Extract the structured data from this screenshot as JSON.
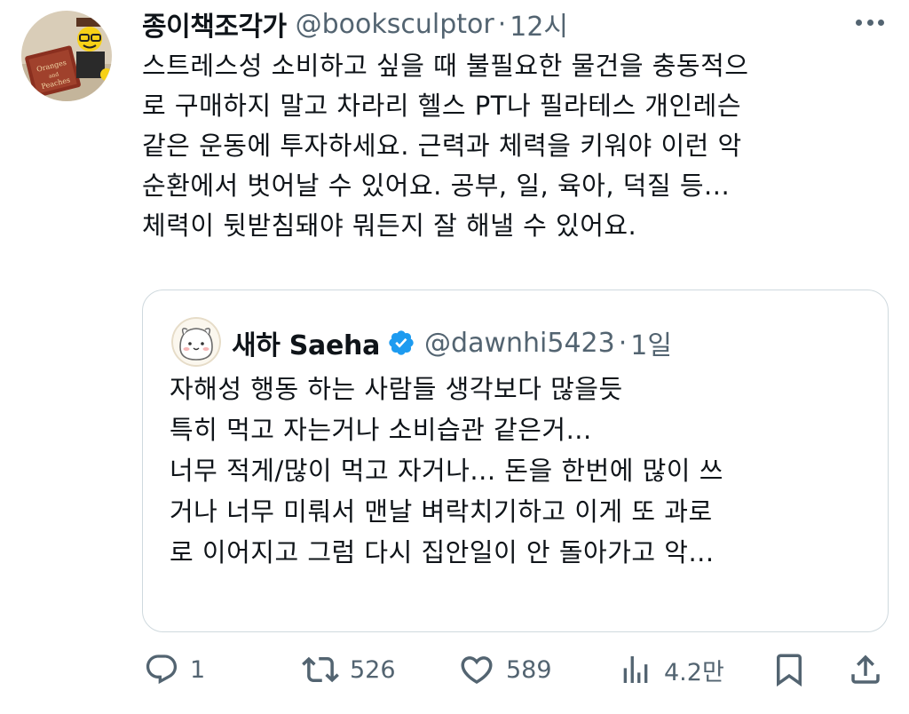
{
  "tweet": {
    "display_name": "종이책조각가",
    "handle": "@booksculptor",
    "separator": "·",
    "time": "12시",
    "lines": [
      "스트레스성 소비하고 싶을 때 불필요한 물건을 충동적으",
      "로 구매하지 말고 차라리 헬스 PT나 필라테스 개인레슨",
      "같은 운동에 투자하세요. 근력과 체력을 키워야 이런 악",
      "순환에서 벗어날 수 있어요. 공부, 일, 육아,  덕질 등...",
      "체력이 뒷받침돼야 뭐든지 잘 해낼 수 있어요."
    ]
  },
  "quote": {
    "display_name": "새하 Saeha",
    "handle": "@dawnhi5423",
    "separator": "·",
    "time": "1일",
    "verified_icon": "verified-badge-icon",
    "lines": [
      "자해성 행동 하는 사람들 생각보다 많을듯",
      "특히 먹고 자는거나 소비습관 같은거...",
      "너무 적게/많이 먹고 자거나... 돈을 한번에 많이 쓰",
      "거나 너무 미뤄서 맨날 벼락치기하고 이게 또 과로",
      "로 이어지고 그럼 다시 집안일이 안 돌아가고 악..."
    ]
  },
  "actions": {
    "reply": {
      "icon": "reply-icon",
      "count": "1"
    },
    "retweet": {
      "icon": "retweet-icon",
      "count": "526"
    },
    "like": {
      "icon": "heart-icon",
      "count": "589"
    },
    "views": {
      "icon": "views-chart-icon",
      "count": "4.2만"
    },
    "bookmark": {
      "icon": "bookmark-icon"
    },
    "share": {
      "icon": "share-icon"
    }
  },
  "colors": {
    "text": "#0f1419",
    "secondary": "#536471",
    "border": "#cfd9de",
    "verified": "#1d9bf0"
  }
}
